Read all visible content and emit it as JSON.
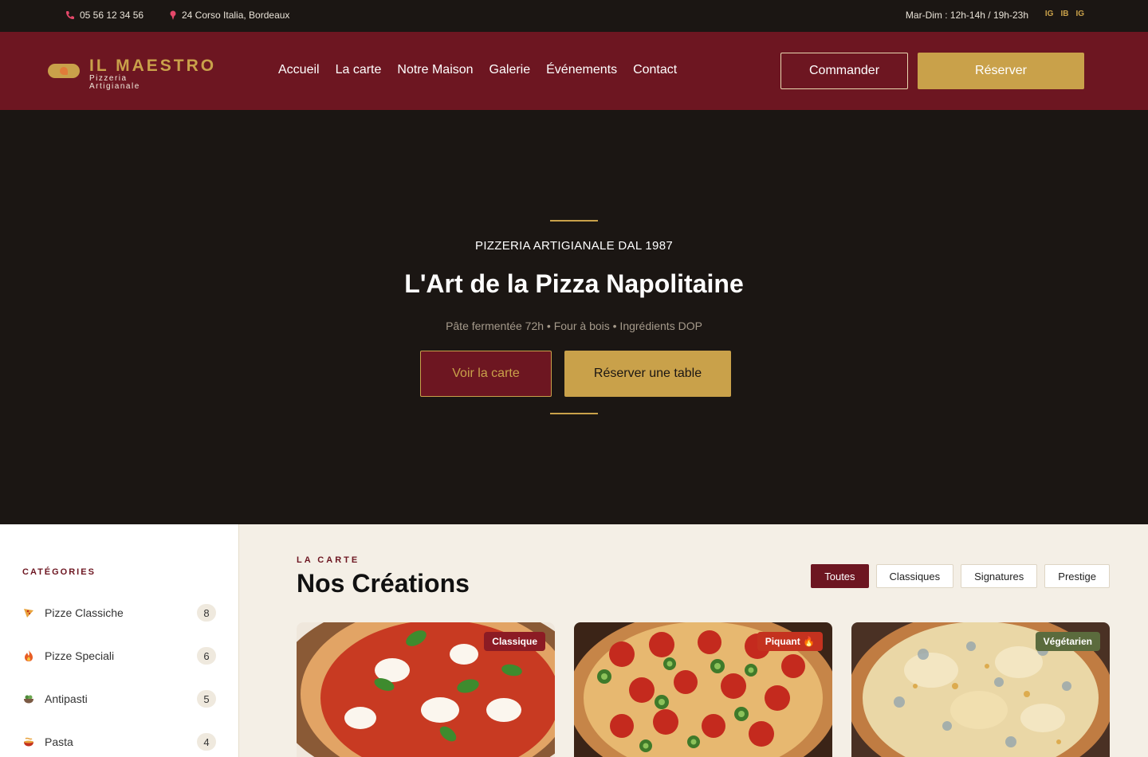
{
  "topbar": {
    "phone": "05 56 12 34 56",
    "address": "24 Corso Italia, Bordeaux",
    "hours": "Mar-Dim : 12h-14h / 19h-23h",
    "social": [
      "IG",
      "IB",
      "IG"
    ]
  },
  "header": {
    "brand": "IL MAESTRO",
    "brand_sub_1": "Pizzeria",
    "brand_sub_2": "Artigianale",
    "nav": [
      "Accueil",
      "La carte",
      "Notre Maison",
      "Galerie",
      "Événements",
      "Contact"
    ],
    "order_label": "Commander",
    "book_label": "Réserver"
  },
  "hero": {
    "eyebrow": "PIZZERIA ARTIGIANALE DAL 1987",
    "title": "L'Art de la Pizza Napolitaine",
    "tagline": "Pâte fermentée 72h • Four à bois • Ingrédients DOP",
    "cta_menu": "Voir la carte",
    "cta_book": "Réserver une table"
  },
  "sidebar": {
    "title": "CATÉGORIES",
    "categories": [
      {
        "label": "Pizze Classiche",
        "count": "8",
        "icon": "pizza-slice-icon"
      },
      {
        "label": "Pizze Speciali",
        "count": "6",
        "icon": "flame-icon"
      },
      {
        "label": "Antipasti",
        "count": "5",
        "icon": "salad-bowl-icon"
      },
      {
        "label": "Pasta",
        "count": "4",
        "icon": "pasta-icon"
      }
    ]
  },
  "main": {
    "kicker": "LA CARTE",
    "title": "Nos Créations",
    "filters": [
      "Toutes",
      "Classiques",
      "Signatures",
      "Prestige"
    ],
    "active_filter": "Toutes",
    "cards": [
      {
        "badge": "Classique",
        "badge_color": "#8c1b24",
        "image": "margherita-pizza-image"
      },
      {
        "badge": "Piquant 🔥",
        "badge_color": "#c4321f",
        "image": "pepperoni-jalapeno-pizza-image"
      },
      {
        "badge": "Végétarien",
        "badge_color": "#5b6b3d",
        "image": "quattro-formaggi-pizza-image"
      }
    ]
  },
  "colors": {
    "burgundy": "#6d1621",
    "gold": "#c9a14a",
    "dark": "#1b1613",
    "cream": "#f4efe6"
  }
}
